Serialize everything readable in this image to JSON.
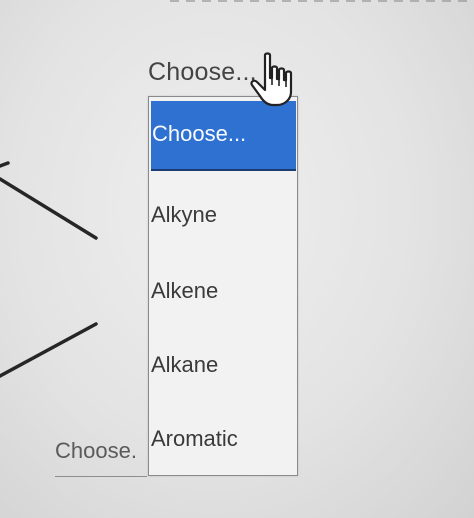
{
  "question": {
    "select_current_label": "Choose..."
  },
  "dropdown": {
    "options": [
      {
        "label": "Choose...",
        "selected": true
      },
      {
        "label": "Alkyne"
      },
      {
        "label": "Alkene"
      },
      {
        "label": "Alkane"
      },
      {
        "label": "Aromatic"
      }
    ]
  },
  "secondary_select": {
    "label": "Choose."
  },
  "colors": {
    "selected_bg": "#2f71d0",
    "selected_text": "#f8fbff",
    "list_bg": "#f2f2f2",
    "text": "#3a3a3a",
    "screen_bg": "#e7e7e7"
  },
  "cursor": {
    "icon": "hand-pointer-icon"
  }
}
